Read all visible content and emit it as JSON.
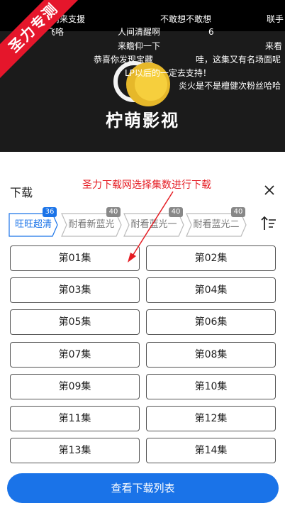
{
  "video": {
    "danmu": [
      "你前来支援",
      "不敢想不敢想",
      "联手",
      "飞咯",
      "人间清醒啊",
      "6",
      "来瞻仰一下",
      "来看",
      "恭喜你发现宝藏",
      "哇，这集又有名场面呢",
      "LP以后的一定去支持！",
      "炎火是不是檀健次粉丝哈哈"
    ],
    "brand": "柠萌影视"
  },
  "watermark": "圣力专测",
  "panel": {
    "title": "下载",
    "annotation": "圣力下载网选择集数进行下载",
    "tabs": [
      {
        "label": "旺旺超清",
        "count": "36",
        "active": true
      },
      {
        "label": "耐看新蓝光",
        "count": "40",
        "active": false
      },
      {
        "label": "耐看蓝光一",
        "count": "40",
        "active": false
      },
      {
        "label": "耐看蓝光二",
        "count": "40",
        "active": false
      }
    ],
    "episodes": [
      "第01集",
      "第02集",
      "第03集",
      "第04集",
      "第05集",
      "第06集",
      "第07集",
      "第08集",
      "第09集",
      "第10集",
      "第11集",
      "第12集",
      "第13集",
      "第14集"
    ],
    "view_list_button": "查看下载列表"
  },
  "colors": {
    "accent": "#1a73e8",
    "annotation": "#e51c23",
    "watermark": "#e5162b"
  }
}
